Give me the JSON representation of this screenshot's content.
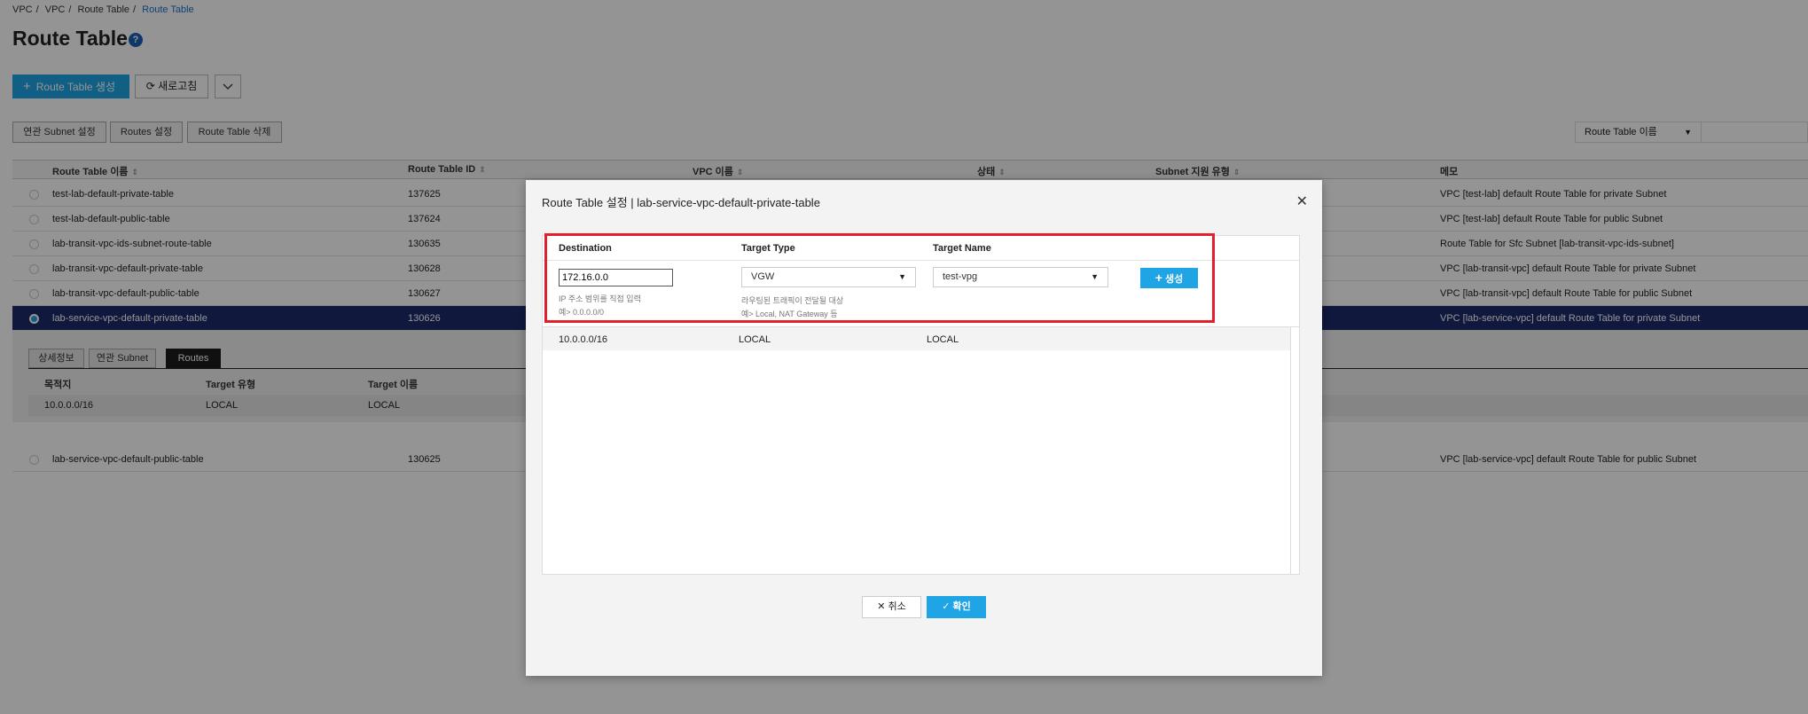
{
  "breadcrumb": [
    "VPC",
    "VPC",
    "Route Table",
    "Route Table"
  ],
  "breadcrumb_sep": "/",
  "page_title": "Route Table",
  "help_icon_text": "?",
  "toolbar": {
    "create_label": "Route Table 생성",
    "refresh_label": "새로고침"
  },
  "sub_buttons": [
    "연관 Subnet 설정",
    "Routes 설정",
    "Route Table 삭제"
  ],
  "filter": {
    "selected": "Route Table 이름"
  },
  "table": {
    "headers": [
      "Route Table 이름",
      "Route Table ID",
      "VPC 이름",
      "상태",
      "Subnet 지원 유형",
      "메모"
    ],
    "rows": [
      {
        "name": "test-lab-default-private-table",
        "id": "137625",
        "memo": "VPC [test-lab] default Route Table for private Subnet"
      },
      {
        "name": "test-lab-default-public-table",
        "id": "137624",
        "memo": "VPC [test-lab] default Route Table for public Subnet"
      },
      {
        "name": "lab-transit-vpc-ids-subnet-route-table",
        "id": "130635",
        "memo": "Route Table for Sfc Subnet [lab-transit-vpc-ids-subnet]"
      },
      {
        "name": "lab-transit-vpc-default-private-table",
        "id": "130628",
        "memo": "VPC [lab-transit-vpc] default Route Table for private Subnet"
      },
      {
        "name": "lab-transit-vpc-default-public-table",
        "id": "130627",
        "memo": "VPC [lab-transit-vpc] default Route Table for public Subnet"
      },
      {
        "name": "lab-service-vpc-default-private-table",
        "id": "130626",
        "memo": "VPC [lab-service-vpc] default Route Table for private Subnet"
      }
    ],
    "last_row": {
      "name": "lab-service-vpc-default-public-table",
      "id": "130625",
      "memo": "VPC [lab-service-vpc] default Route Table for public Subnet"
    }
  },
  "detail": {
    "tabs": [
      "상세정보",
      "연관 Subnet",
      "Routes"
    ],
    "headers": [
      "목적지",
      "Target 유형",
      "Target 이름"
    ],
    "row": [
      "10.0.0.0/16",
      "LOCAL",
      "LOCAL"
    ]
  },
  "modal": {
    "title": "Route Table 설정 | lab-service-vpc-default-private-table",
    "form_labels": [
      "Destination",
      "Target Type",
      "Target Name"
    ],
    "destination_value": "172.16.0.0",
    "destination_hint1": "IP 주소 범위를 직접 입력",
    "destination_hint2": "예> 0.0.0.0/0",
    "target_type_value": "VGW",
    "target_type_hint1": "라우팅된 트래픽이 전달될 대상",
    "target_type_hint2": "예> Local, NAT Gateway 등",
    "target_name_value": "test-vpg",
    "add_label": "생성",
    "route_row": [
      "10.0.0.0/16",
      "LOCAL",
      "LOCAL"
    ],
    "cancel_label": "취소",
    "ok_label": "확인"
  }
}
